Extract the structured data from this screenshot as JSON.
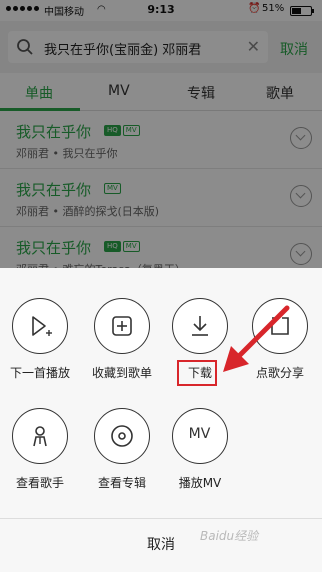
{
  "status": {
    "carrier": "中国移动",
    "time": "9:13",
    "battery_percent": "51%",
    "battery_level": 0.51
  },
  "search": {
    "query": "我只在乎你(宝丽金) 邓丽君",
    "cancel_label": "取消"
  },
  "tabs": [
    "单曲",
    "MV",
    "专辑",
    "歌单"
  ],
  "songs": [
    {
      "title": "我只在乎你",
      "badges": [
        "HQ",
        "MV"
      ],
      "meta": "邓丽君 • 我只在乎你"
    },
    {
      "title": "我只在乎你",
      "badges": [
        "MV"
      ],
      "meta": "邓丽君 • 酒醉的探戈(日本版)"
    },
    {
      "title": "我只在乎你",
      "badges": [
        "HQ",
        "MV"
      ],
      "meta": "邓丽君 • 难忘的Terasa（复黑王）"
    }
  ],
  "sheet": {
    "actions": [
      {
        "label": "下一首播放",
        "icon": "play-next-icon"
      },
      {
        "label": "收藏到歌单",
        "icon": "add-to-playlist-icon"
      },
      {
        "label": "下载",
        "icon": "download-icon"
      },
      {
        "label": "点歌分享",
        "icon": "share-icon"
      },
      {
        "label": "查看歌手",
        "icon": "singer-icon"
      },
      {
        "label": "查看专辑",
        "icon": "album-icon"
      },
      {
        "label": "播放MV",
        "icon": "mv-icon",
        "icon_text": "MV"
      }
    ],
    "cancel_label": "取消"
  },
  "annotation": {
    "highlight_color": "#d8262b"
  },
  "colors": {
    "accent": "#2aa74a"
  },
  "watermark": "Baidu经验"
}
